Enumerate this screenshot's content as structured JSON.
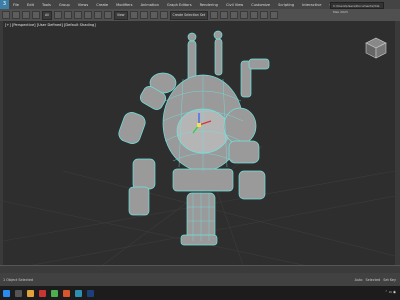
{
  "menubar": {
    "items": [
      "File",
      "Edit",
      "Tools",
      "Group",
      "Views",
      "Create",
      "Modifiers",
      "Animation",
      "Graph Editors",
      "Rendering",
      "Civil View",
      "Customize",
      "Scripting",
      "Interactive",
      "Content",
      "Arnold",
      "Help"
    ],
    "workspace_value": "C:\\Users\\Users\\Documents\\3ds Max 2023"
  },
  "toolbar": {
    "selection_filter": "All",
    "view_label": "View",
    "selection_set": "Create Selection Set"
  },
  "viewport": {
    "label": "[+] [Perspective] [User Defined] [Default Shading]"
  },
  "statusbar": {
    "selection": "1 Object Selected",
    "auto_key": "Auto",
    "set_key": "Set Key",
    "selected": "Selected"
  },
  "taskbar": {
    "apps": [
      "start",
      "search",
      "file-explorer",
      "edge",
      "chrome",
      "firefox",
      "3dsmax",
      "photoshop"
    ]
  },
  "colors": {
    "wireframe": "#6fe3e0",
    "mesh": "#9a9a9a",
    "background": "#2e2e2e"
  }
}
